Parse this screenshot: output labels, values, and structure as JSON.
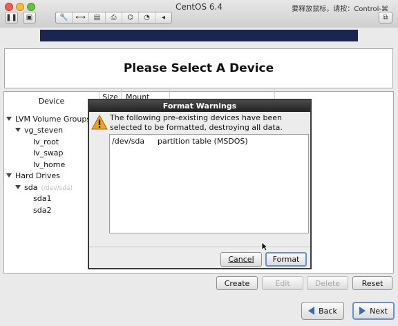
{
  "window": {
    "title": "CentOS 6.4",
    "release_hint": "要释放鼠标，请按：Control-⌘"
  },
  "installer": {
    "title": "Please Select A Device",
    "columns": {
      "device": "Device",
      "size": "Size",
      "mount": "Mount Point/"
    },
    "tree": [
      {
        "label": "LVM Volume Groups",
        "level": 0,
        "expander": true
      },
      {
        "label": "vg_steven",
        "level": 1,
        "expander": true
      },
      {
        "label": "lv_root",
        "level": 2
      },
      {
        "label": "lv_swap",
        "level": 2
      },
      {
        "label": "lv_home",
        "level": 2
      },
      {
        "label": "Hard Drives",
        "level": 0,
        "expander": true
      },
      {
        "label": "sda",
        "level": 1,
        "expander": true,
        "note": "(/dev/sda)"
      },
      {
        "label": "sda1",
        "level": 2
      },
      {
        "label": "sda2",
        "level": 2
      }
    ],
    "actions": {
      "create": "Create",
      "edit": "Edit",
      "delete": "Delete",
      "reset": "Reset"
    },
    "nav": {
      "back": "Back",
      "next": "Next"
    }
  },
  "dialog": {
    "title": "Format Warnings",
    "message": "The following pre-existing devices have been selected to be formatted, destroying all data.",
    "devices": [
      {
        "device": "/dev/sda",
        "description": "partition table (MSDOS)"
      }
    ],
    "cancel": "Cancel",
    "format": "Format"
  },
  "colors": {
    "banner": "#1a2550",
    "warning": "#f0a020",
    "nav_arrow": "#3a6ab0"
  }
}
